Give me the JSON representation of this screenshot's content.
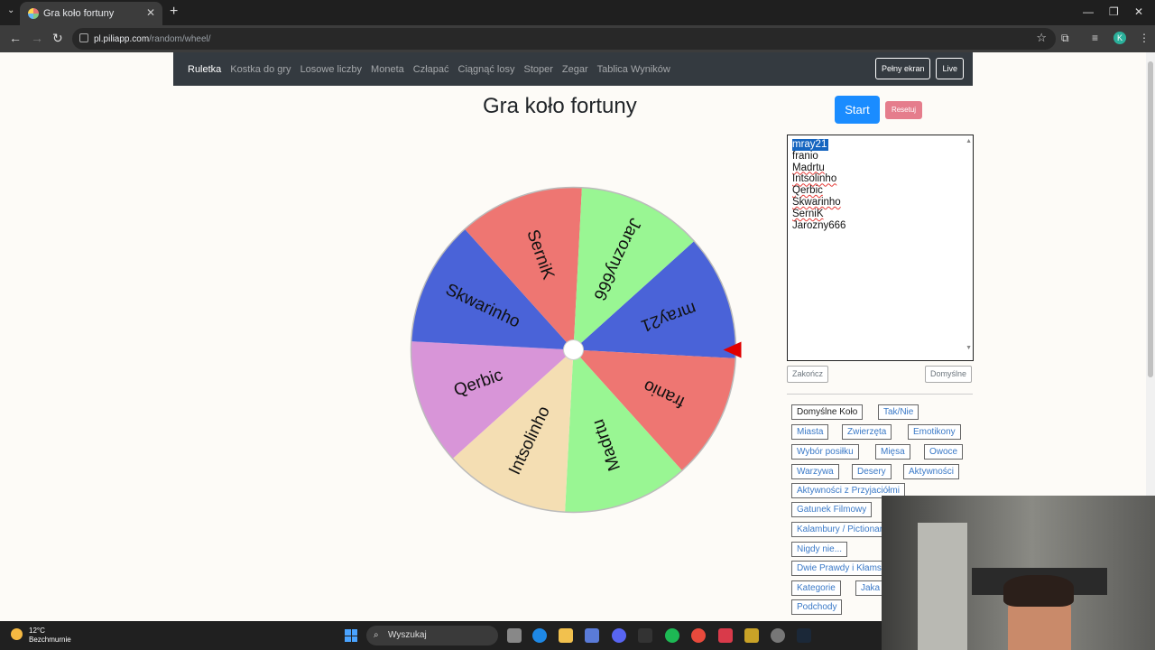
{
  "browser": {
    "tab_title": "Gra koło fortuny",
    "url_domain": "pl.piliapp.com",
    "url_path": "/random/wheel/",
    "profile_initial": "K"
  },
  "navbar": {
    "items": [
      "Ruletka",
      "Kostka do gry",
      "Losowe liczby",
      "Moneta",
      "Człapać",
      "Ciągnąć losy",
      "Stoper",
      "Zegar",
      "Tablica Wyników"
    ],
    "fullscreen": "Pełny ekran",
    "live": "Live"
  },
  "page": {
    "title": "Gra koło fortuny",
    "start": "Start",
    "reset": "Resetuj",
    "finish": "Zakończ",
    "default": "Domyślne"
  },
  "entries": [
    "mray21",
    "franio",
    "Madrtu",
    "Intsolinho",
    "Qerbic",
    "Skwarinho",
    "SerniK",
    "Jarozny666"
  ],
  "wheel": {
    "segments": [
      {
        "label": "mray21",
        "color": "#4a63d8"
      },
      {
        "label": "franio",
        "color": "#ee7672"
      },
      {
        "label": "Madrtu",
        "color": "#99f693"
      },
      {
        "label": "Intsolinho",
        "color": "#f4deb3"
      },
      {
        "label": "Qerbic",
        "color": "#d895d8"
      },
      {
        "label": "Skwarinho",
        "color": "#4a63d8"
      },
      {
        "label": "SerniK",
        "color": "#ee7672"
      },
      {
        "label": "Jarozny666",
        "color": "#99f693"
      }
    ],
    "pointer_color": "#e00000"
  },
  "presets": [
    "Domyślne Koło",
    "Tak/Nie",
    "Miasta",
    "Zwierzęta",
    "Emotikony",
    "Wybór posiłku",
    "Mięsa",
    "Owoce",
    "Warzywa",
    "Desery",
    "Aktywności",
    "Aktywności z Przyjaciółmi",
    "Gatunek Filmowy",
    "Kalambury / Pictionary",
    "Nigdy nie...",
    "Dwie Prawdy i Kłamstwo",
    "Kategorie",
    "Jaka",
    "Podchody"
  ],
  "taskbar": {
    "temp": "12°C",
    "weather": "Bezchmurnie",
    "search": "Wyszukaj"
  }
}
